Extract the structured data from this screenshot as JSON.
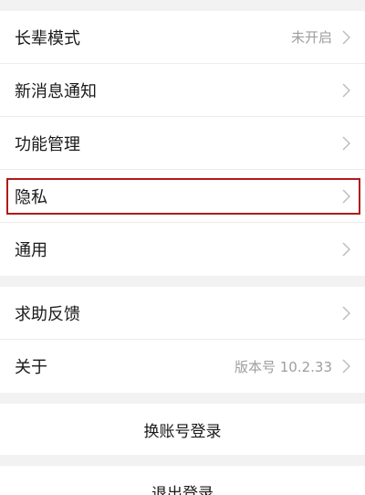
{
  "settings": {
    "group1": [
      {
        "label": "长辈模式",
        "value": "未开启"
      },
      {
        "label": "新消息通知",
        "value": ""
      },
      {
        "label": "功能管理",
        "value": ""
      },
      {
        "label": "隐私",
        "value": ""
      },
      {
        "label": "通用",
        "value": ""
      }
    ],
    "group2": [
      {
        "label": "求助反馈",
        "value": ""
      },
      {
        "label": "关于",
        "value": "版本号 10.2.33"
      }
    ]
  },
  "actions": {
    "switch_account": "换账号登录",
    "logout": "退出登录"
  },
  "icons": {
    "row_arrow": "chevron-right-icon"
  },
  "colors": {
    "highlight_border": "#b01a1a",
    "background": "#f2f2f2",
    "value_text": "#9e9e9e"
  }
}
